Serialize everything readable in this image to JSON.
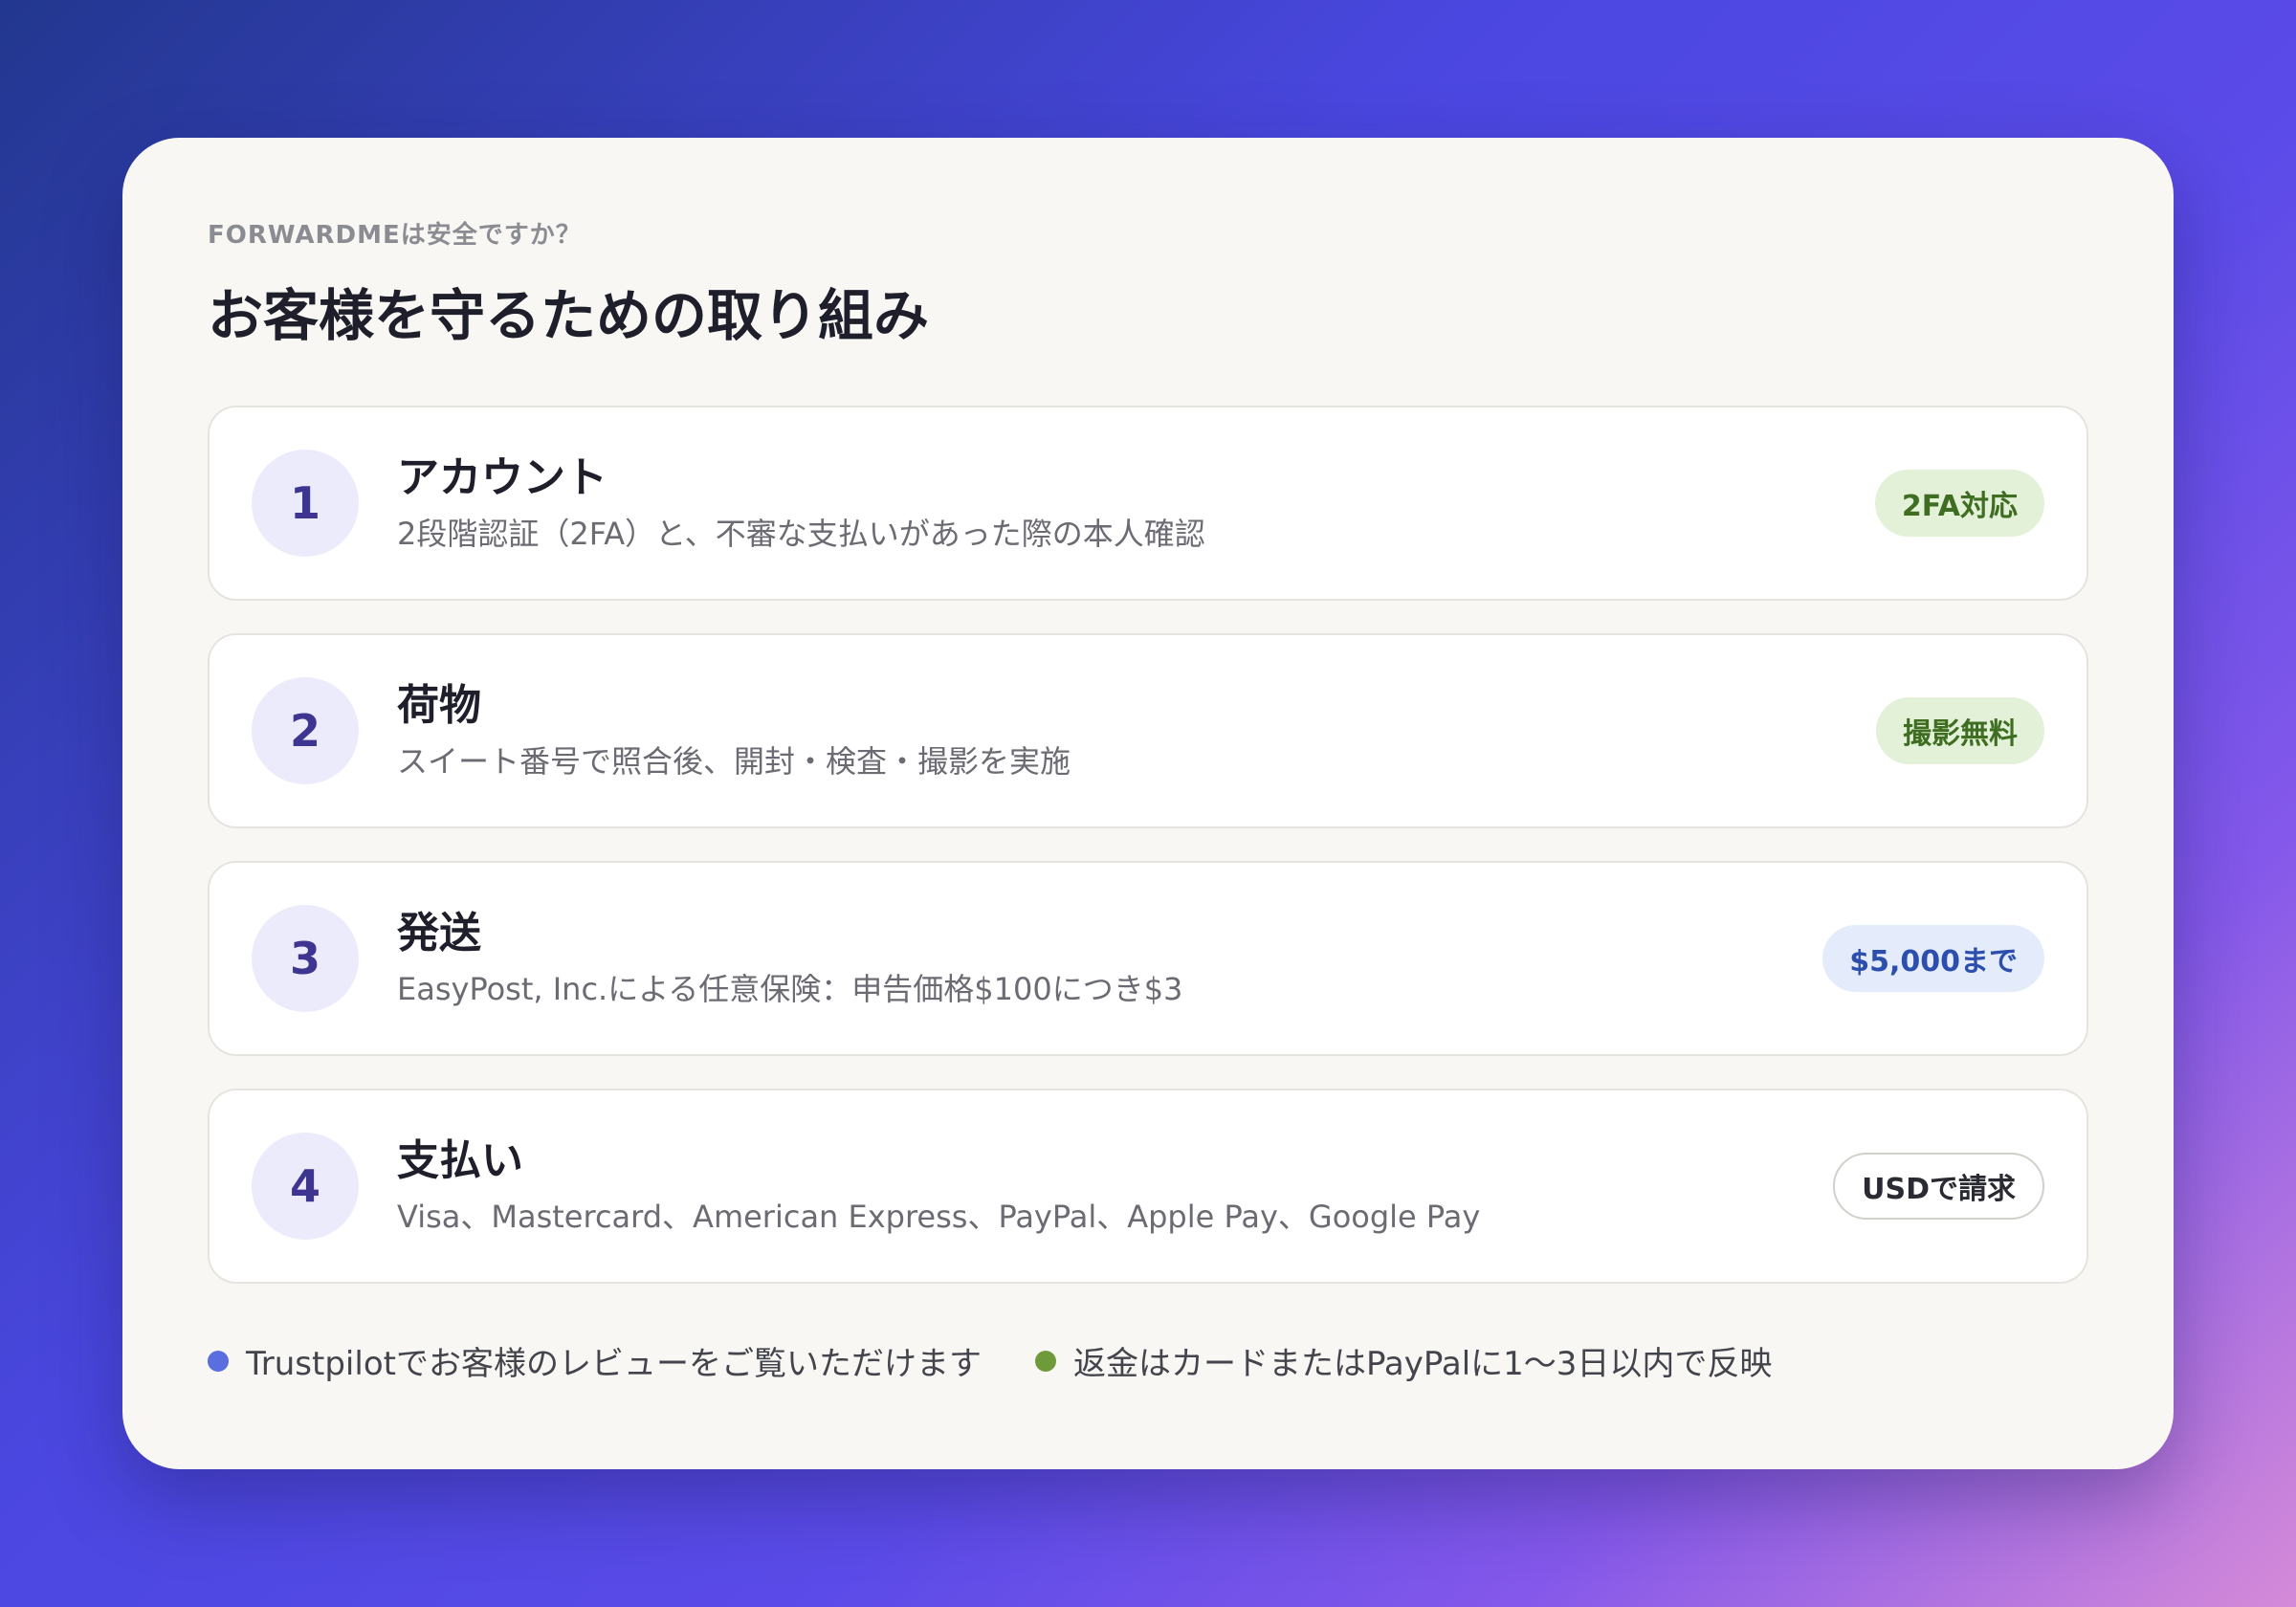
{
  "header": {
    "eyebrow": "FORWARDMEは安全ですか？",
    "title": "お客様を守るための取り組み"
  },
  "items": [
    {
      "number": "1",
      "title": "アカウント",
      "description": "2段階認証（2FA）と、不審な支払いがあった際の本人確認",
      "badge": "2FA対応",
      "badge_style": "green"
    },
    {
      "number": "2",
      "title": "荷物",
      "description": "スイート番号で照合後、開封・検査・撮影を実施",
      "badge": "撮影無料",
      "badge_style": "green"
    },
    {
      "number": "3",
      "title": "発送",
      "description": "EasyPost, Inc.による任意保険：申告価格$100につき$3",
      "badge": "$5,000まで",
      "badge_style": "blue"
    },
    {
      "number": "4",
      "title": "支払い",
      "description": "Visa、Mastercard、American Express、PayPal、Apple Pay、Google Pay",
      "badge": "USDで請求",
      "badge_style": "outline"
    }
  ],
  "footer": {
    "notes": [
      {
        "text": "Trustpilotでお客様のレビューをご覧いただけます",
        "dot_color": "#5b6ee0"
      },
      {
        "text": "返金はカードまたはPayPalに1〜3日以内で反映",
        "dot_color": "#6e9a3a"
      }
    ]
  },
  "colors": {
    "accent": "#3d3590",
    "badge_green_bg": "#e3f1d9",
    "badge_green_text": "#3f6e22",
    "badge_blue_bg": "#e4ecfb",
    "badge_blue_text": "#2c4fae"
  }
}
